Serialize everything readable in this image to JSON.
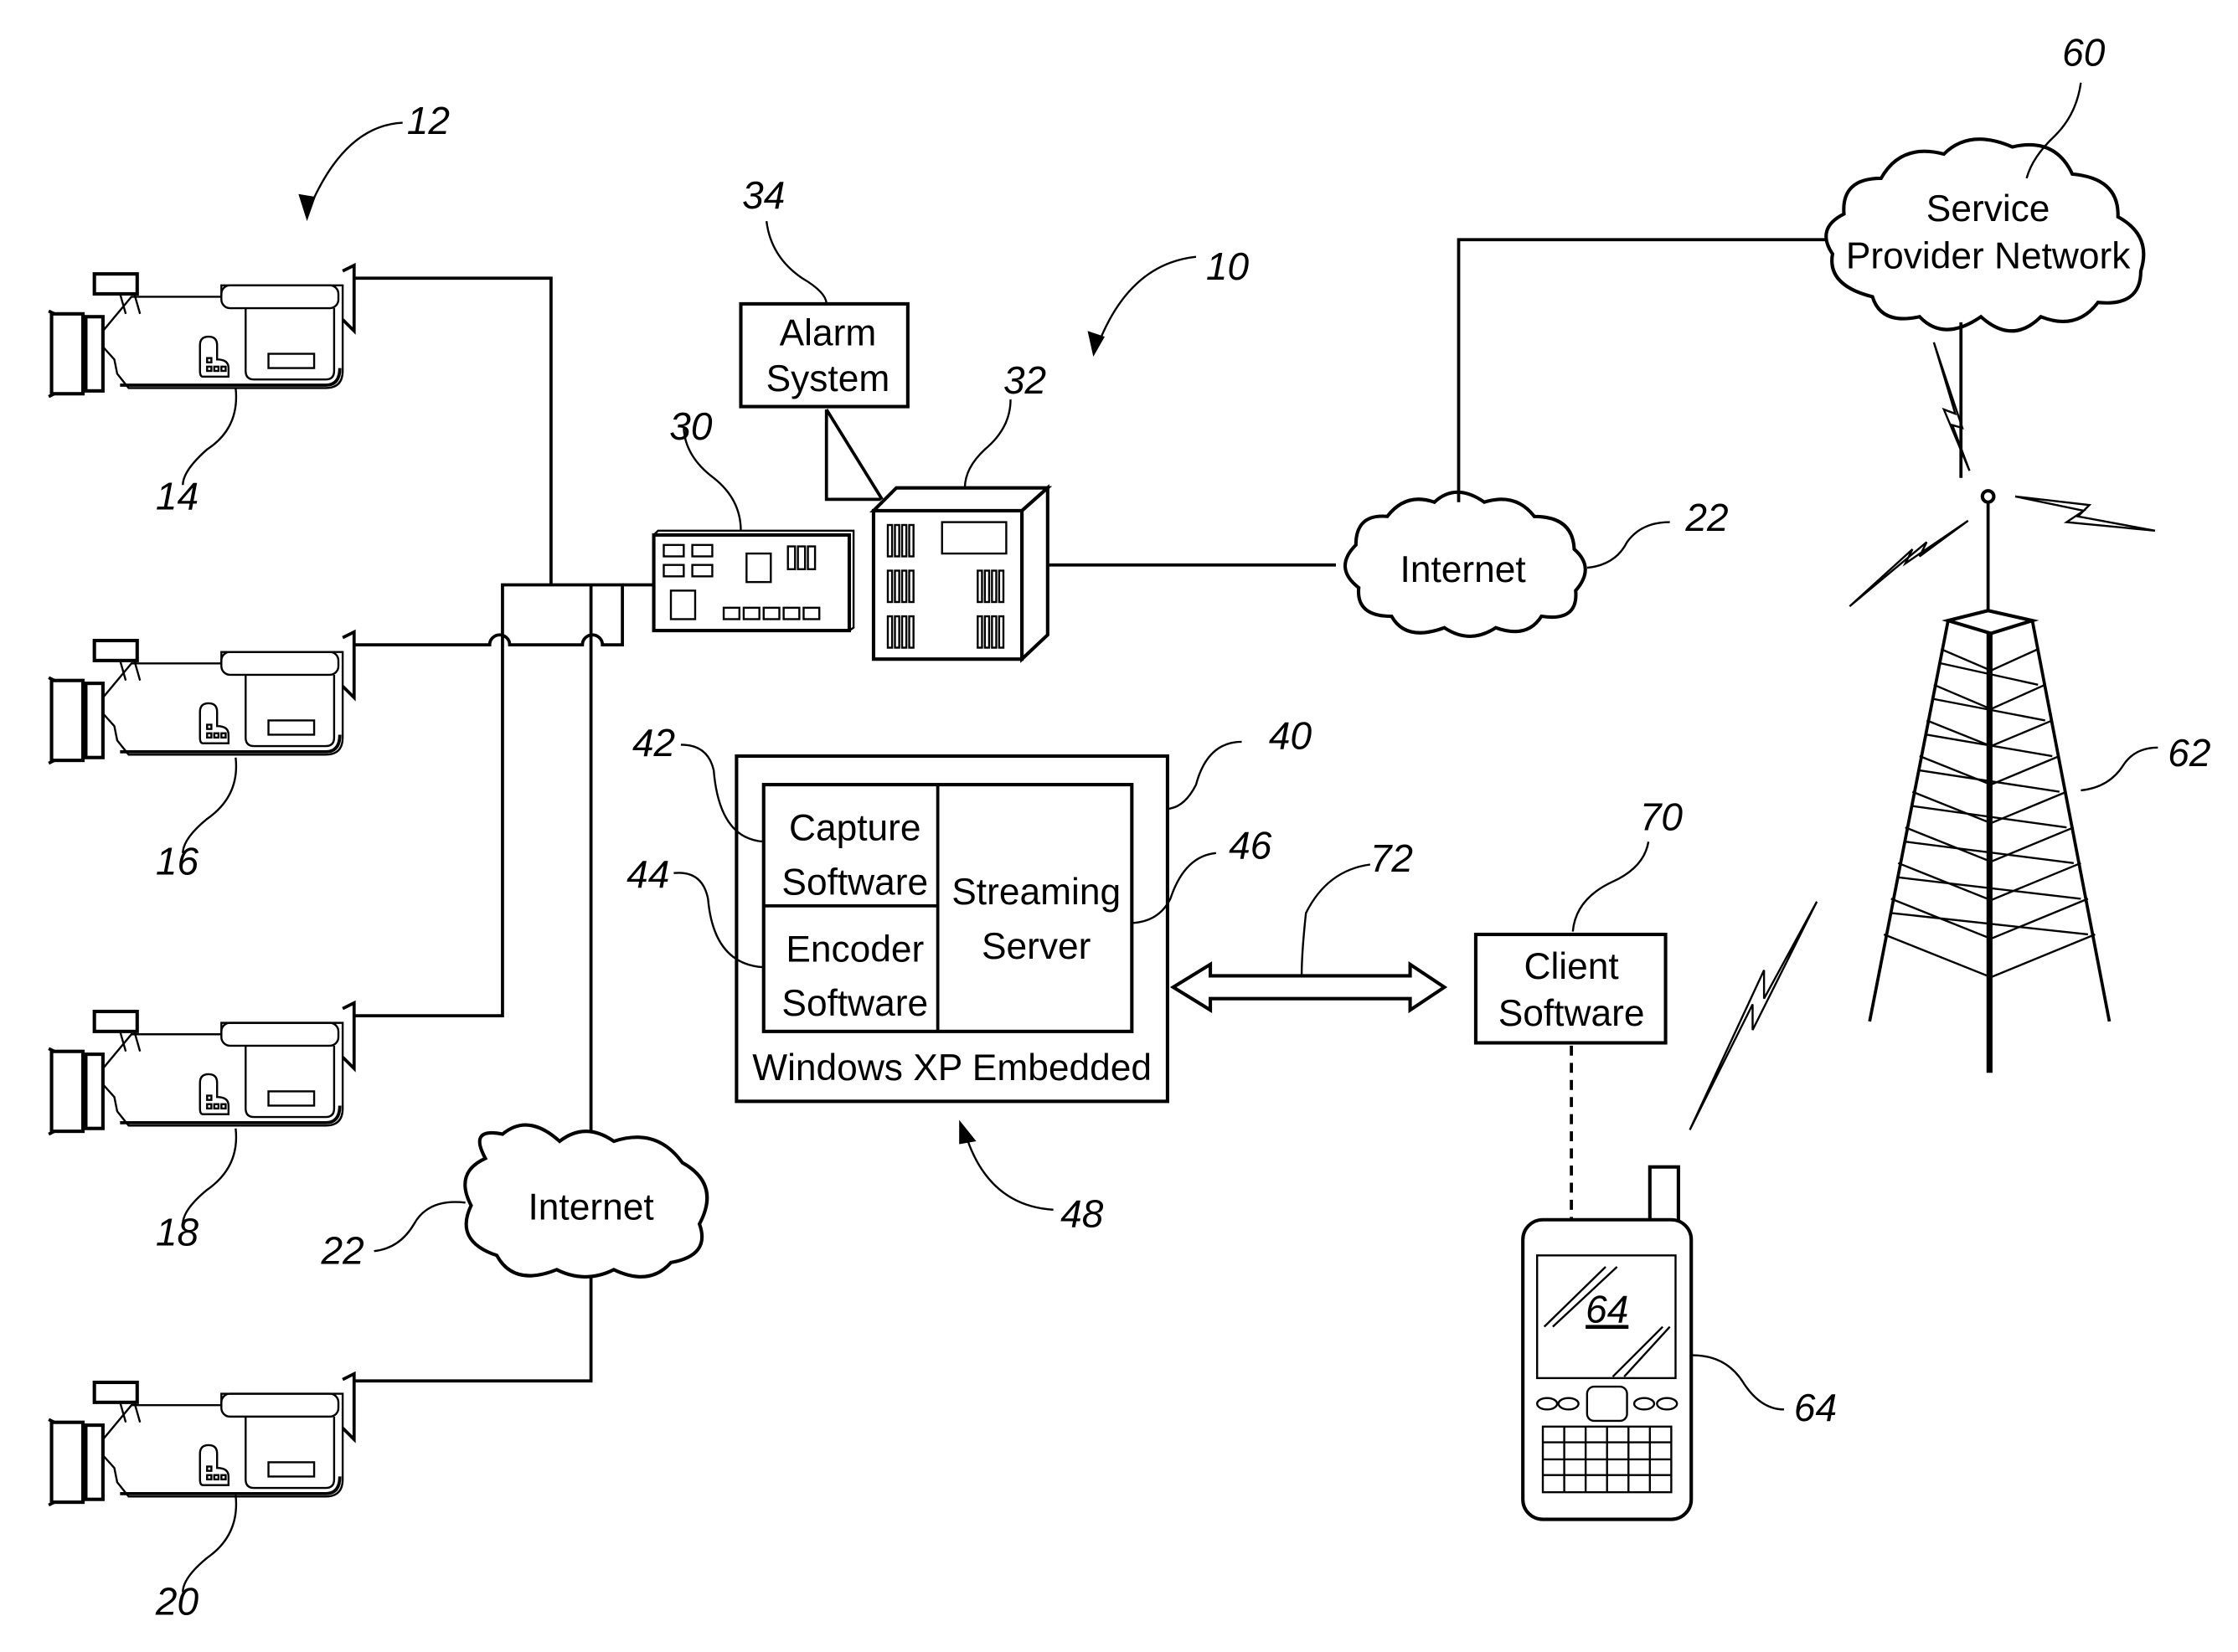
{
  "figure": {
    "reference_numerals": {
      "system": "10",
      "camera_group": "12",
      "camera_1": "14",
      "camera_2": "16",
      "camera_3": "18",
      "camera_4": "20",
      "internet_left": "22",
      "internet_right": "22",
      "dvr": "30",
      "server": "32",
      "alarm": "34",
      "software_box": "40",
      "capture": "42",
      "encoder": "44",
      "streaming": "46",
      "os": "48",
      "service_provider": "60",
      "tower": "62",
      "phone": "64",
      "phone_screen": "64",
      "client": "70",
      "link": "72"
    },
    "labels": {
      "alarm_line1": "Alarm",
      "alarm_line2": "System",
      "internet_left": "Internet",
      "internet_right": "Internet",
      "service_line1": "Service",
      "service_line2": "Provider Network",
      "capture_line1": "Capture",
      "capture_line2": "Software",
      "encoder_line1": "Encoder",
      "encoder_line2": "Software",
      "streaming_line1": "Streaming",
      "streaming_line2": "Server",
      "os_label": "Windows XP Embedded",
      "client_line1": "Client",
      "client_line2": "Software"
    }
  }
}
